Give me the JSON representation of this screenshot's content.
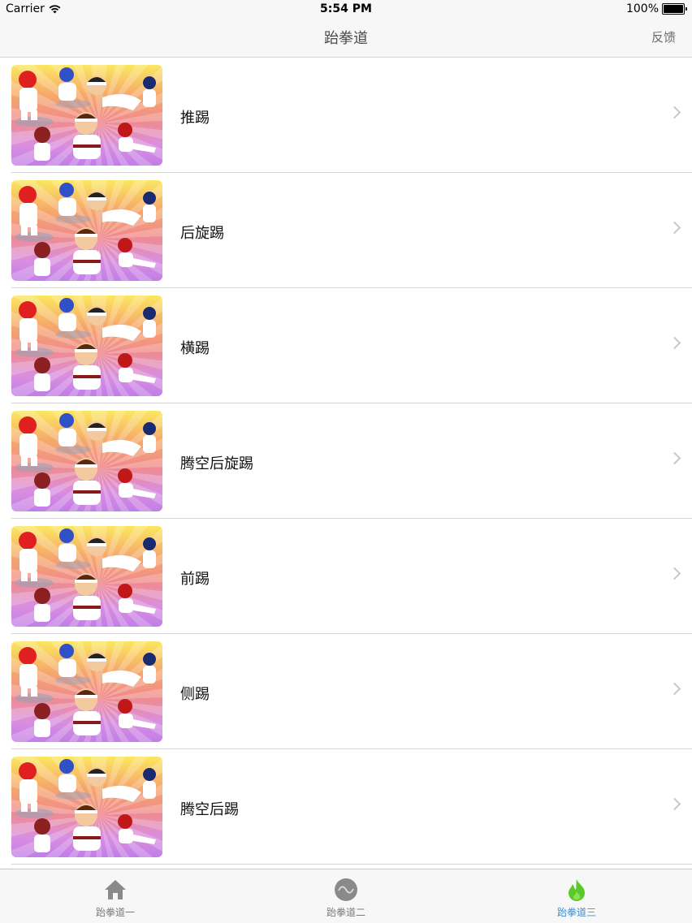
{
  "status_bar": {
    "carrier": "Carrier",
    "time": "5:54 PM",
    "battery": "100%"
  },
  "nav": {
    "title": "跆拳道",
    "right_button": "反馈"
  },
  "list": {
    "items": [
      {
        "label": "推踢"
      },
      {
        "label": "后旋踢"
      },
      {
        "label": "横踢"
      },
      {
        "label": "腾空后旋踢"
      },
      {
        "label": "前踢"
      },
      {
        "label": "侧踢"
      },
      {
        "label": "腾空后踢"
      }
    ]
  },
  "tabs": [
    {
      "label": "跆拳道一",
      "icon": "home-icon",
      "active": false
    },
    {
      "label": "跆拳道二",
      "icon": "wave-circle-icon",
      "active": false
    },
    {
      "label": "跆拳道三",
      "icon": "flame-icon",
      "active": true
    }
  ],
  "colors": {
    "active_tab": "#3f8fd0",
    "flame": "#5cc92a",
    "inactive_icon": "#8a8a8a"
  }
}
